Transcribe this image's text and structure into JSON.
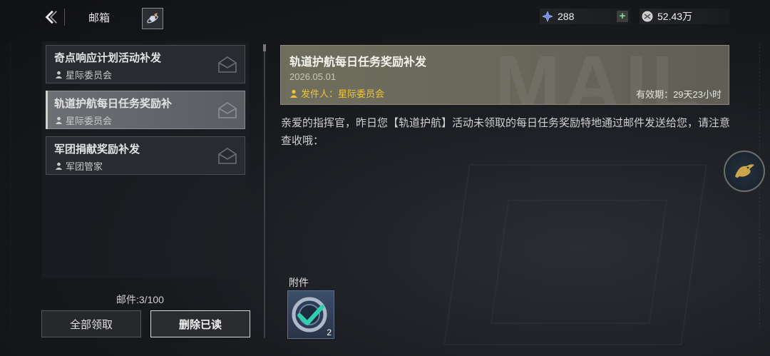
{
  "header": {
    "title": "邮箱",
    "back_icon": "back-arrow-icon",
    "emblem_icon": "planet-rocket-icon"
  },
  "resources": [
    {
      "icon": "crystal-icon",
      "value": "288",
      "has_plus": true
    },
    {
      "icon": "coin-icon",
      "value": "52.43万"
    }
  ],
  "mail_list": [
    {
      "title": "奇点响应计划活动补发",
      "sender": "星际委员会",
      "selected": false
    },
    {
      "title": "轨道护航每日任务奖励补",
      "sender": "星际委员会",
      "selected": true
    },
    {
      "title": "军团捐献奖励补发",
      "sender": "军团管家",
      "selected": false
    }
  ],
  "mail_count": "邮件:3/100",
  "buttons": {
    "claim_all": "全部领取",
    "delete_read": "删除已读"
  },
  "detail": {
    "title": "轨道护航每日任务奖励补发",
    "date": "2026.05.01",
    "sender": "发件人：星际委员会",
    "expire": "有效期：29天23小时",
    "watermark": "MAIL",
    "body": "亲爱的指挥官，昨日您【轨道护航】活动未领取的每日任务奖励特地通过邮件发送给您，请注意查收哦：",
    "attachment_label": "附件",
    "attachment": {
      "icon": "ring-token-icon",
      "quantity": "2",
      "claimed": true
    }
  },
  "colors": {
    "sender_highlight": "#f1c534",
    "header_bg": "#6f6e5e",
    "accent_plus": "#8bd88f"
  }
}
